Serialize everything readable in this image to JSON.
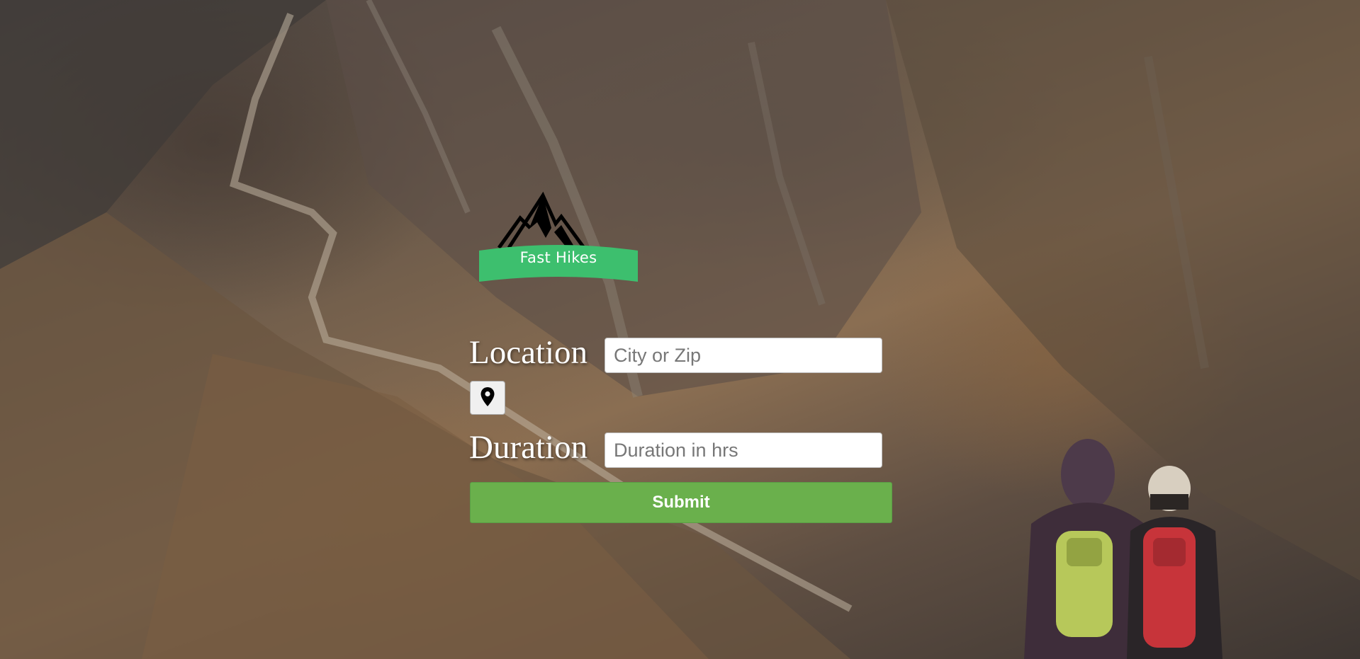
{
  "app": {
    "name": "Fast Hikes"
  },
  "form": {
    "location": {
      "label": "Location",
      "placeholder": "City or Zip",
      "value": ""
    },
    "geolocate_icon": "map-pin-icon",
    "duration": {
      "label": "Duration",
      "placeholder": "Duration in hrs",
      "value": ""
    },
    "submit_label": "Submit"
  },
  "colors": {
    "logo_banner": "#3dbf6e",
    "submit": "#6ab04c",
    "label_text": "#ffffff"
  }
}
